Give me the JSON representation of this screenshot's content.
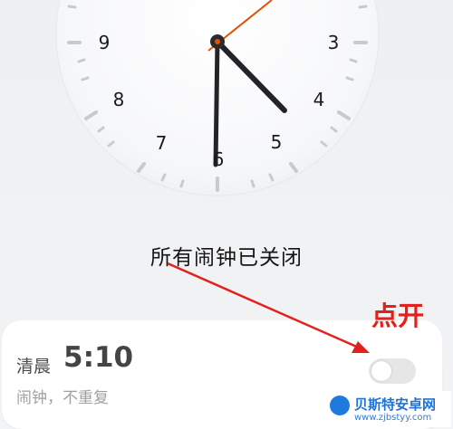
{
  "clock": {
    "numerals": {
      "n3": "3",
      "n4": "4",
      "n5": "5",
      "n6": "6",
      "n7": "7",
      "n8": "8",
      "n9": "9"
    },
    "status_text": "所有闹钟已关闭"
  },
  "alarm": {
    "period": "清晨",
    "time": "5:10",
    "subtitle": "闹钟，不重复",
    "enabled": false
  },
  "annotation": {
    "text": "点开",
    "color": "#e4201c"
  },
  "watermark": {
    "brand": "贝斯特安卓网",
    "url": "www.zjbstyy.com"
  },
  "colors": {
    "accent": "#e65100",
    "arrow": "#e4201c",
    "toggle_off": "#e6e6e6"
  }
}
